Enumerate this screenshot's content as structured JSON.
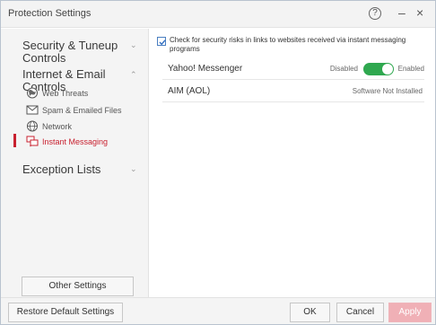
{
  "window": {
    "title": "Protection Settings"
  },
  "titlebar": {
    "help_glyph": "?",
    "minimize_glyph": "–",
    "close_glyph": "×"
  },
  "sidebar": {
    "sections": [
      {
        "label": "Security & Tuneup Controls",
        "expanded": false
      },
      {
        "label": "Internet & Email Controls",
        "expanded": true
      },
      {
        "label": "Exception Lists",
        "expanded": false
      }
    ],
    "subitems": [
      {
        "label": "Web Threats",
        "icon": "globe-icon"
      },
      {
        "label": "Spam & Emailed Files",
        "icon": "envelope-icon"
      },
      {
        "label": "Network",
        "icon": "network-globe-icon"
      },
      {
        "label": "Instant Messaging",
        "icon": "chat-bubbles-icon",
        "active": true
      }
    ],
    "other_settings_label": "Other Settings"
  },
  "main": {
    "check_links": {
      "checked": true,
      "label": "Check for security risks in links to websites received via instant messaging programs"
    },
    "messengers": [
      {
        "name": "Yahoo! Messenger",
        "state_off_label": "Disabled",
        "state_on_label": "Enabled",
        "enabled": true
      },
      {
        "name": "AIM (AOL)",
        "status": "Software Not Installed"
      }
    ]
  },
  "footer": {
    "restore_label": "Restore Default Settings",
    "ok_label": "OK",
    "cancel_label": "Cancel",
    "apply_label": "Apply"
  },
  "colors": {
    "accent": "#c8202f",
    "toggle_on": "#2fa84f",
    "apply_disabled": "#f0b0b6"
  }
}
